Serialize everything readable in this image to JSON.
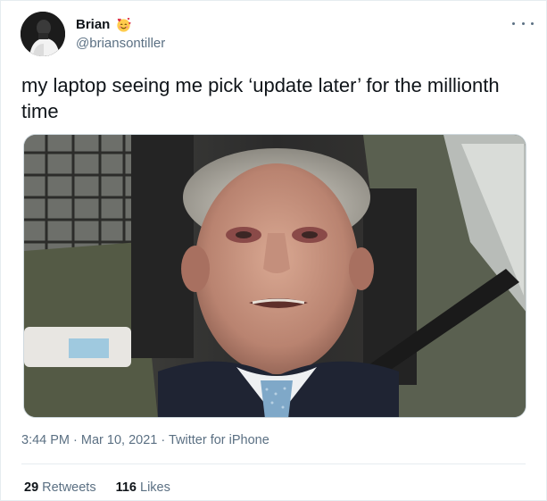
{
  "author": {
    "display_name": "Brian",
    "emoji_icon": "smiling-face-with-hearts-icon",
    "handle": "@briansontiller"
  },
  "more_icon": "more-options-icon",
  "tweet": {
    "text": "my laptop seeing me pick ‘update later’ for the millionth time"
  },
  "media": {
    "icon": "photo-meme-image"
  },
  "meta": {
    "time": "3:44 PM",
    "separator1": " · ",
    "date": "Mar 10, 2021",
    "separator2": " · ",
    "source": "Twitter for iPhone"
  },
  "stats": {
    "retweets_count": "29",
    "retweets_label": "Retweets",
    "likes_count": "116",
    "likes_label": "Likes"
  },
  "colors": {
    "primary_text": "#0f1419",
    "secondary_text": "#5b7083",
    "divider": "#e6ecf0"
  }
}
